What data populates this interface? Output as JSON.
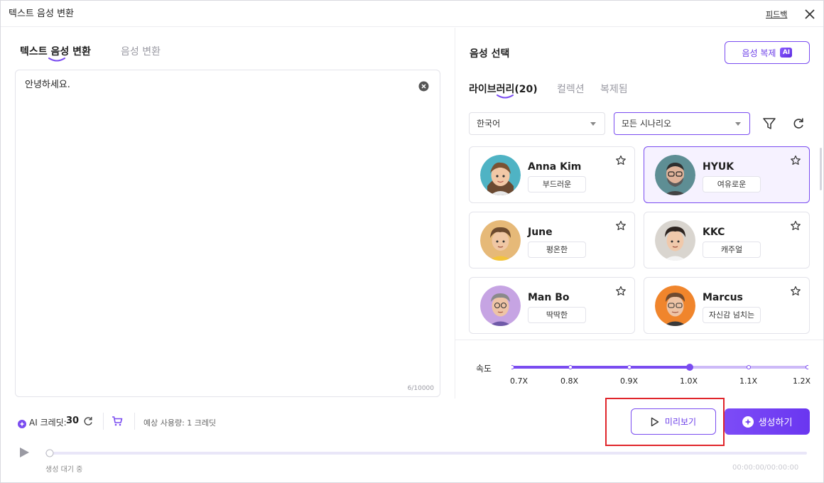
{
  "window": {
    "title": "텍스트 음성 변환",
    "feedback_link": "피드백",
    "close_icon": "close-icon"
  },
  "left_panel": {
    "tabs": [
      {
        "label": "텍스트 음성 변환",
        "active": true
      },
      {
        "label": "음성 변환",
        "active": false
      }
    ],
    "editor": {
      "text": "안녕하세요.",
      "char_count": "6/10000"
    }
  },
  "right_panel": {
    "title": "음성 선택",
    "clone_button": {
      "label": "음성 복제",
      "badge": "AI"
    },
    "tabs": [
      {
        "label": "라이브러리(20)",
        "active": true
      },
      {
        "label": "컬렉션",
        "active": false
      },
      {
        "label": "복제됨",
        "active": false
      }
    ],
    "filters": {
      "language": "한국어",
      "scenario": "모든 시나리오"
    },
    "voices": [
      {
        "name": "Anna Kim",
        "tag": "부드러운",
        "selected": false
      },
      {
        "name": "HYUK",
        "tag": "여유로운",
        "selected": true
      },
      {
        "name": "June",
        "tag": "평온한",
        "selected": false
      },
      {
        "name": "KKC",
        "tag": "캐주얼",
        "selected": false
      },
      {
        "name": "Man Bo",
        "tag": "딱딱한",
        "selected": false
      },
      {
        "name": "Marcus",
        "tag": "자신감 넘치는",
        "selected": false
      }
    ],
    "speed": {
      "label": "속도",
      "ticks": [
        "0.7X",
        "0.8X",
        "0.9X",
        "1.0X",
        "1.1X",
        "1.2X"
      ],
      "value": "1.0X"
    }
  },
  "bottom_bar": {
    "credit_label": "AI 크레딧:",
    "credit_value": "30",
    "usage": "예상 사용량: 1 크레딧",
    "preview_button": "미리보기",
    "generate_button": "생성하기",
    "status": "생성 대기 중",
    "time": "00:00:00/00:00:00",
    "progress": 0
  },
  "colors": {
    "accent": "#7a4cf0",
    "highlight_box": "#e0252b"
  }
}
